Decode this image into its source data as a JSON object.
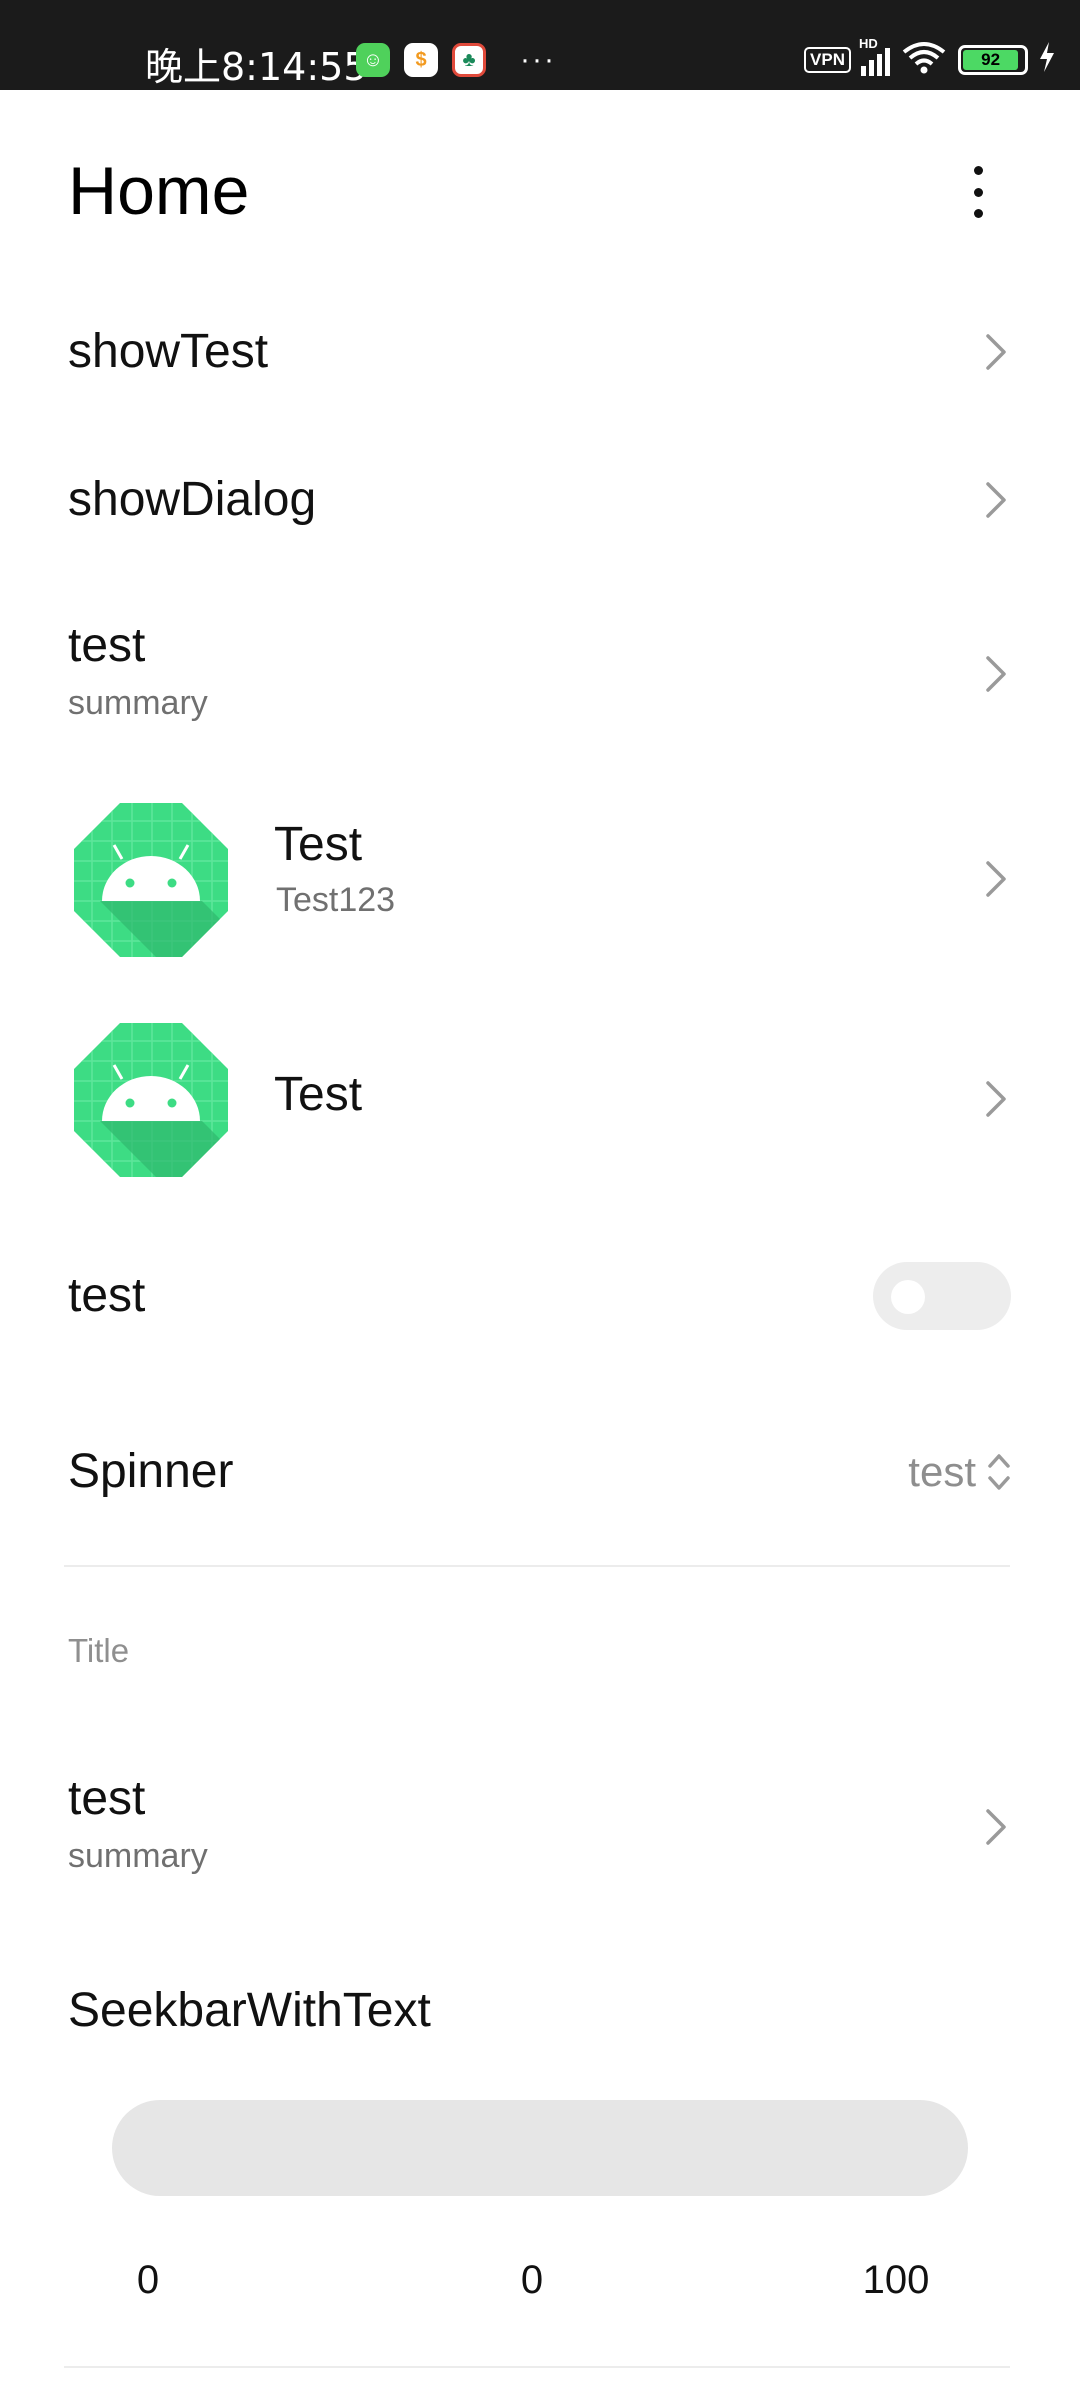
{
  "status_bar": {
    "time": "晚上8:14:55",
    "notif_apps": [
      "green-app-icon",
      "orange-app-icon",
      "red-app-icon"
    ],
    "more": "···",
    "vpn": "VPN",
    "hd": "HD",
    "battery": "92"
  },
  "header": {
    "title": "Home"
  },
  "items": {
    "show_test": {
      "title": "showTest"
    },
    "show_dialog": {
      "title": "showDialog"
    },
    "test_summary": {
      "title": "test",
      "summary": "summary"
    },
    "icon_test_1": {
      "title": "Test",
      "summary": "Test123"
    },
    "icon_test_2": {
      "title": "Test"
    },
    "switch_test": {
      "title": "test",
      "checked": false
    },
    "spinner": {
      "title": "Spinner",
      "value": "test"
    }
  },
  "category": {
    "title": "Title",
    "test_summary": {
      "title": "test",
      "summary": "summary"
    }
  },
  "seekbar": {
    "title": "SeekbarWithText",
    "min": "0",
    "current": "0",
    "max": "100",
    "value": 0
  },
  "colors": {
    "accent_green": "#3ddc84",
    "toggle_off": "#ededed",
    "track": "#e6e6e6"
  }
}
